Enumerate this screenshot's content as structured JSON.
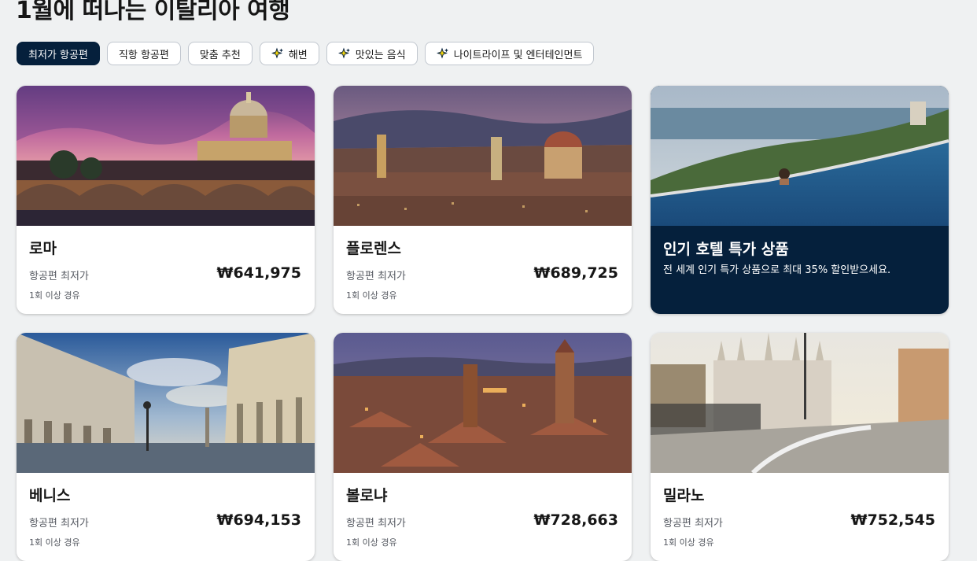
{
  "page": {
    "title": "1월에 떠나는 이탈리아 여행"
  },
  "filters": [
    {
      "label": "최저가 항공편",
      "active": true,
      "icon": ""
    },
    {
      "label": "직항 항공편",
      "active": false,
      "icon": ""
    },
    {
      "label": "맞춤 추천",
      "active": false,
      "icon": ""
    },
    {
      "label": "해변",
      "active": false,
      "icon": "sparkle-icon"
    },
    {
      "label": "맛있는 음식",
      "active": false,
      "icon": "sparkle-icon"
    },
    {
      "label": "나이트라이프 및 엔터테인먼트",
      "active": false,
      "icon": "sparkle-icon"
    }
  ],
  "cards": [
    {
      "city": "로마",
      "label": "항공편 최저가",
      "price": "₩641,975",
      "stops": "1회 이상 경유"
    },
    {
      "city": "플로렌스",
      "label": "항공편 최저가",
      "price": "₩689,725",
      "stops": "1회 이상 경유"
    },
    {
      "city": "베니스",
      "label": "항공편 최저가",
      "price": "₩694,153",
      "stops": "1회 이상 경유"
    },
    {
      "city": "볼로냐",
      "label": "항공편 최저가",
      "price": "₩728,663",
      "stops": "1회 이상 경유"
    },
    {
      "city": "밀라노",
      "label": "항공편 최저가",
      "price": "₩752,545",
      "stops": "1회 이상 경유"
    }
  ],
  "promo": {
    "title": "인기 호텔 특가 상품",
    "description": "전 세계 인기 특가 상품으로 최대 35% 할인받으세요."
  },
  "colors": {
    "brand_dark": "#05203c",
    "page_bg": "#eff1f2",
    "accent_yellow": "#f5d60b"
  }
}
